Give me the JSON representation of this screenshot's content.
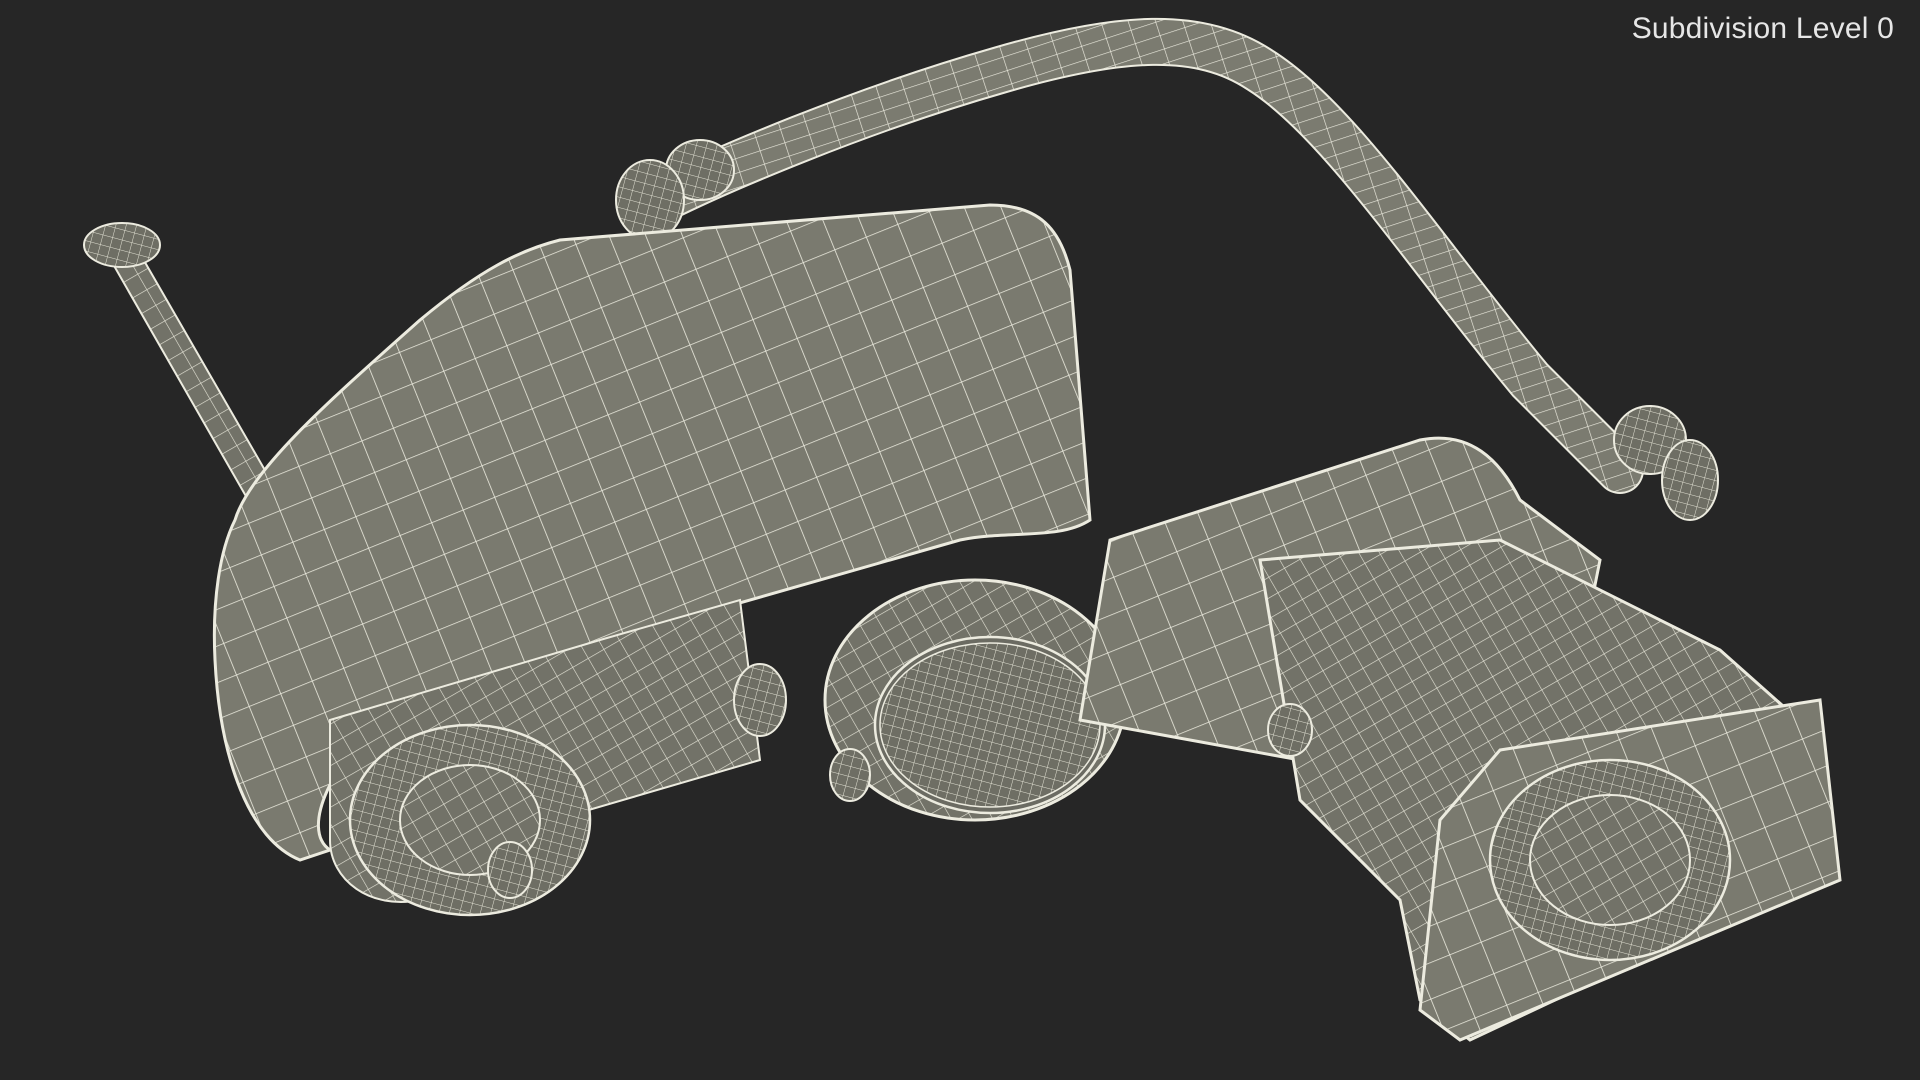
{
  "viewport": {
    "subdivision_label": "Subdivision Level 0",
    "background_color": "#262626",
    "model_color": "#7d7d72",
    "wire_color": "#e8e8dc"
  }
}
